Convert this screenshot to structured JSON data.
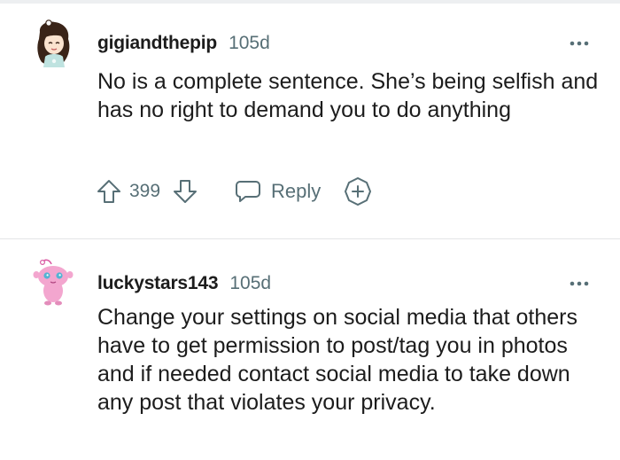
{
  "comments": [
    {
      "username": "gigiandthepip",
      "age": "105d",
      "body": "No is a complete sentence. She’s being selfish and has no right to demand you to do anything",
      "score": "399",
      "reply_label": "Reply"
    },
    {
      "username": "luckystars143",
      "age": "105d",
      "body": "Change your settings on social media that others have to get permission to post/tag you in photos and if needed contact social media to take down any post that violates your privacy."
    }
  ]
}
